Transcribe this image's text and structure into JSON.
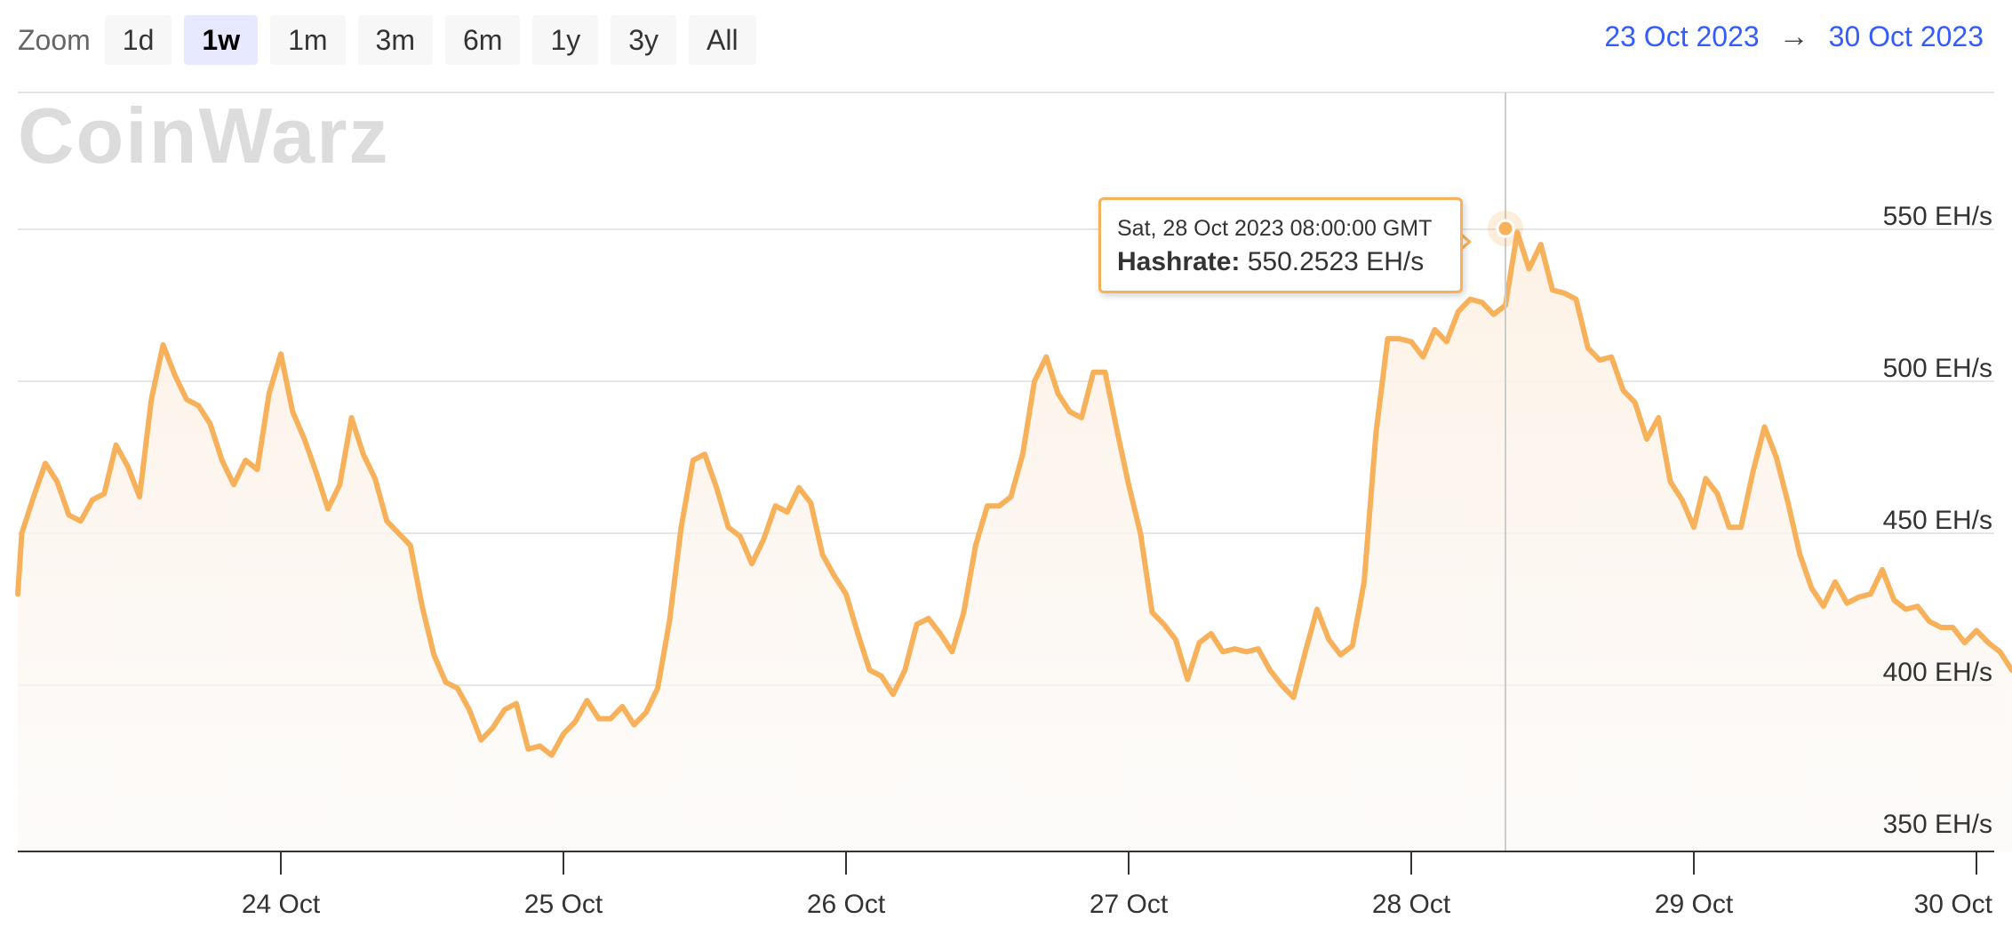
{
  "toolbar": {
    "zoom_label": "Zoom",
    "buttons": [
      "1d",
      "1w",
      "1m",
      "3m",
      "6m",
      "1y",
      "3y",
      "All"
    ],
    "active": "1w"
  },
  "range": {
    "from": "23 Oct 2023",
    "arrow": "→",
    "to": "30 Oct 2023"
  },
  "watermark": "CoinWarz",
  "tooltip": {
    "date": "Sat, 28 Oct 2023 08:00:00 GMT",
    "series_name": "Hashrate:",
    "value_text": "550.2523 EH/s"
  },
  "colors": {
    "line": "#f7b15a",
    "area_top": "#fdf1e4",
    "gridline": "#e6e6e6",
    "axis": "#333333",
    "link": "#335cff",
    "active_button": "#e6e9ff"
  },
  "chart_data": {
    "type": "area",
    "title": "",
    "xlabel": "",
    "ylabel": "",
    "x_unit": "hour offset from 23 Oct 2023 00:00 GMT, 1 point per hour",
    "x_ticks": [
      "24 Oct",
      "25 Oct",
      "26 Oct",
      "27 Oct",
      "28 Oct",
      "29 Oct",
      "30 Oct"
    ],
    "y_ticks": [
      "350 EH/s",
      "400 EH/s",
      "450 EH/s",
      "500 EH/s",
      "550 EH/s"
    ],
    "ylim": [
      350,
      600
    ],
    "grid": true,
    "legend": "none",
    "highlight": {
      "date": "28 Oct 2023 08:00",
      "value": 550.25
    },
    "series": [
      {
        "name": "Hashrate",
        "start": "23 Oct 2023 02:00",
        "values": [
          450,
          462,
          473,
          467,
          456,
          454,
          461,
          463,
          479,
          472,
          462,
          494,
          512,
          502,
          494,
          492,
          486,
          474,
          466,
          474,
          471,
          496,
          509,
          490,
          481,
          470,
          458,
          466,
          488,
          476,
          468,
          454,
          450,
          446,
          426,
          410,
          401,
          399,
          392,
          382,
          386,
          392,
          394,
          379,
          380,
          377,
          384,
          388,
          395,
          389,
          389,
          393,
          387,
          391,
          399,
          421,
          452,
          474,
          476,
          465,
          452,
          449,
          440,
          448,
          459,
          457,
          465,
          460,
          443,
          436,
          430,
          417,
          405,
          403,
          397,
          405,
          420,
          422,
          417,
          411,
          424,
          446,
          459,
          459,
          462,
          476,
          500,
          508,
          496,
          490,
          488,
          503,
          503,
          484,
          466,
          450,
          424,
          420,
          415,
          402,
          414,
          417,
          411,
          412,
          411,
          412,
          405,
          400,
          396,
          411,
          425,
          415,
          410,
          413,
          434,
          483,
          514,
          514,
          513,
          508,
          517,
          513,
          523,
          527,
          526,
          522,
          525,
          549,
          537,
          545,
          530,
          529,
          527,
          511,
          507,
          508,
          497,
          493,
          481,
          488,
          467,
          461,
          452,
          468,
          463,
          452,
          452,
          470,
          485,
          475,
          460,
          443,
          432,
          426,
          434,
          427,
          429,
          430,
          438,
          428,
          425,
          426,
          421,
          419,
          419,
          414,
          418,
          414,
          411,
          405
        ]
      }
    ]
  }
}
